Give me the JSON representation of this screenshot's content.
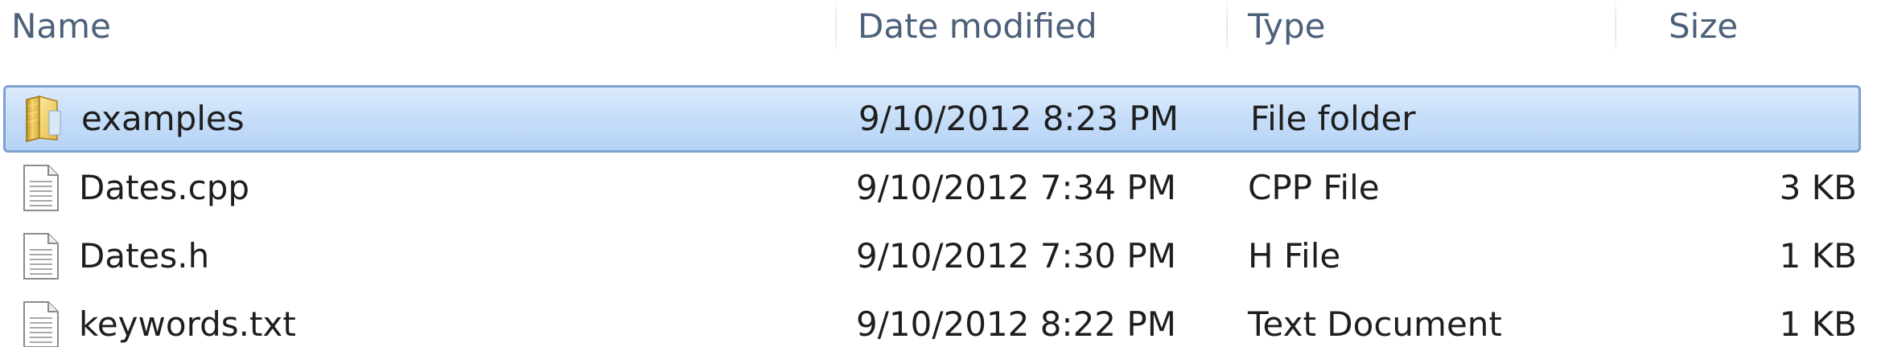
{
  "columns": {
    "name": "Name",
    "date_modified": "Date modified",
    "type": "Type",
    "size": "Size"
  },
  "files": [
    {
      "name": "examples",
      "date_modified": "9/10/2012 8:23 PM",
      "type": "File folder",
      "size": "",
      "icon": "folder-icon",
      "selected": true
    },
    {
      "name": "Dates.cpp",
      "date_modified": "9/10/2012 7:34 PM",
      "type": "CPP File",
      "size": "3 KB",
      "icon": "document-icon",
      "selected": false
    },
    {
      "name": "Dates.h",
      "date_modified": "9/10/2012 7:30 PM",
      "type": "H File",
      "size": "1 KB",
      "icon": "document-icon",
      "selected": false
    },
    {
      "name": "keywords.txt",
      "date_modified": "9/10/2012 8:22 PM",
      "type": "Text Document",
      "size": "1 KB",
      "icon": "document-icon",
      "selected": false
    }
  ],
  "colors": {
    "header_text": "#4c607a",
    "selection_fill": "#c4dcf8",
    "selection_border": "#7da2ce",
    "row_text": "#1e1e1e",
    "folder_yellow": "#e8c14a"
  }
}
